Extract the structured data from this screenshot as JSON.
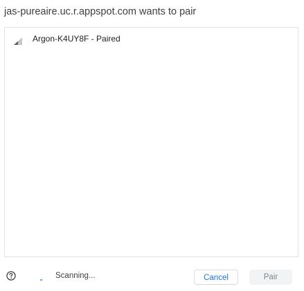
{
  "dialog": {
    "title": "jas-pureaire.uc.r.appspot.com wants to pair"
  },
  "devices": [
    {
      "label": "Argon-K4UY8F - Paired",
      "icon": "signal-strength-icon"
    }
  ],
  "footer": {
    "help_icon": "help-circle-icon",
    "status_text": "Scanning...",
    "cancel_label": "Cancel",
    "pair_label": "Pair"
  },
  "colors": {
    "accent": "#1a73e8",
    "disabled_text": "#80868b",
    "spinner": "#4a8fe7"
  }
}
